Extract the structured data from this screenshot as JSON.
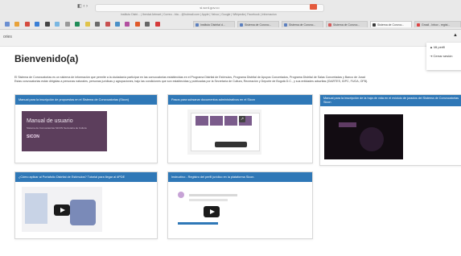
{
  "browser": {
    "address": "si.scrd.gov.co",
    "bookmarks": "Instituto Distri... | Iberdat Artmart | Correo - bta... @hotmail.com | Apple | Yahoo | Google | Wikipedia | Facebook | Informacion",
    "tabs": [
      {
        "label": "Instituto Distrital d..."
      },
      {
        "label": "Sistema de Convoc..."
      },
      {
        "label": "Sistema de Convoc..."
      },
      {
        "label": "Sistema de Convoc..."
      },
      {
        "label": "Sistema de Convoc..."
      },
      {
        "label": "Gmail - Inbox - regist..."
      }
    ]
  },
  "header": {
    "breadcrumb": "ories",
    "user_menu": {
      "my_profile": "Mi perfil",
      "logout": "Cerrar sesión"
    }
  },
  "main": {
    "title": "Bienvenido(a)",
    "intro_line1": "El Sistema de Convocatorias es un sistema de información que permite a la ciudadanía participar en las convocatorias establecidas en el Programa Distrital de Estímulos, Programa Distrital de Apoyos Concertados, Programa Distrital de Salas Concertadas y Banco de Jurad",
    "intro_line2": "Estas convocatorias están dirigidas a personas naturales, personas jurídicas y agrupaciones, bajo las condiciones que son establecidas y publicadas por la Secretaría de Cultura, Recreación y Deporte de Bogotá D.C., y sus entidades adscritas (IDARTES, IDPC, FUGA, OFB).",
    "cards": [
      {
        "title": "Manual para la inscripción de propuestas en el Sistema de Convocatorias (Sicon)",
        "thumb_heading": "Manual de usuario",
        "thumb_subtitle": "Sistema de Convocatorias SiCON Secretaría de Cultura",
        "thumb_brand": "SICON"
      },
      {
        "title": "Pasos para subsanar documentos administrativos en el Sicon"
      },
      {
        "title": "Manual para la inscripción de la hoja de vida en el módulo de jurados del Sistema de Convocatorias Sicon"
      },
      {
        "title": "¿Cómo aplicar al Portafolio Distrital de Estímulos? Tutorial para llegar al #PDE"
      },
      {
        "title": "Instructivo - Registro del perfil jurídico en la plataforma Sicon."
      }
    ]
  },
  "colors": {
    "accent": "#2f78b7",
    "sicon_purple": "#5c3e5c"
  }
}
